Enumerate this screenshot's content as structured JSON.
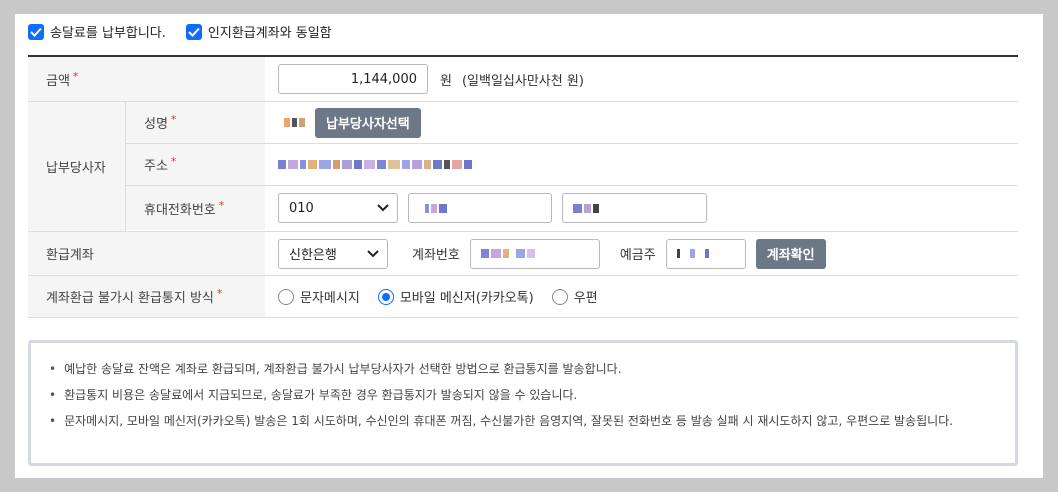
{
  "top_checks": [
    {
      "label": "송달료를 납부합니다.",
      "checked": true
    },
    {
      "label": "인지환급계좌와 동일함",
      "checked": true
    }
  ],
  "amount": {
    "label": "금액",
    "value": "1,144,000",
    "unit": "원",
    "text": "(일백일십사만사천 원)"
  },
  "payer": {
    "group_label": "납부당사자",
    "name_label": "성명",
    "select_button": "납부당사자선택",
    "address_label": "주소",
    "phone_label": "휴대전화번호",
    "phone_prefix": "010"
  },
  "refund": {
    "label": "환급계좌",
    "bank": "신한은행",
    "account_label": "계좌번호",
    "holder_label": "예금주",
    "confirm_button": "계좌확인"
  },
  "notify": {
    "label": "계좌환급 불가시 환급통지 방식",
    "options": [
      {
        "label": "문자메시지",
        "selected": false
      },
      {
        "label": "모바일 메신저(카카오톡)",
        "selected": true
      },
      {
        "label": "우편",
        "selected": false
      }
    ]
  },
  "required_mark": "*",
  "notices": [
    "예납한 송달료 잔액은 계좌로 환급되며, 계좌환급 불가시 납부당사자가 선택한 방법으로 환급통지를 발송합니다.",
    "환급통지 비용은 송달료에서 지급되므로, 송달료가 부족한 경우 환급통지가 발송되지 않을 수 있습니다.",
    "문자메시지, 모바일 메신저(카카오톡) 발송은 1회 시도하며, 수신인의 휴대폰 꺼짐, 수신불가한 음영지역, 잘못된 전화번호 등 발송 실패 시 재시도하지 않고, 우편으로 발송됩니다."
  ],
  "colors": {
    "accent": "#0d6efd",
    "button": "#6c7787",
    "required": "#e03131"
  }
}
